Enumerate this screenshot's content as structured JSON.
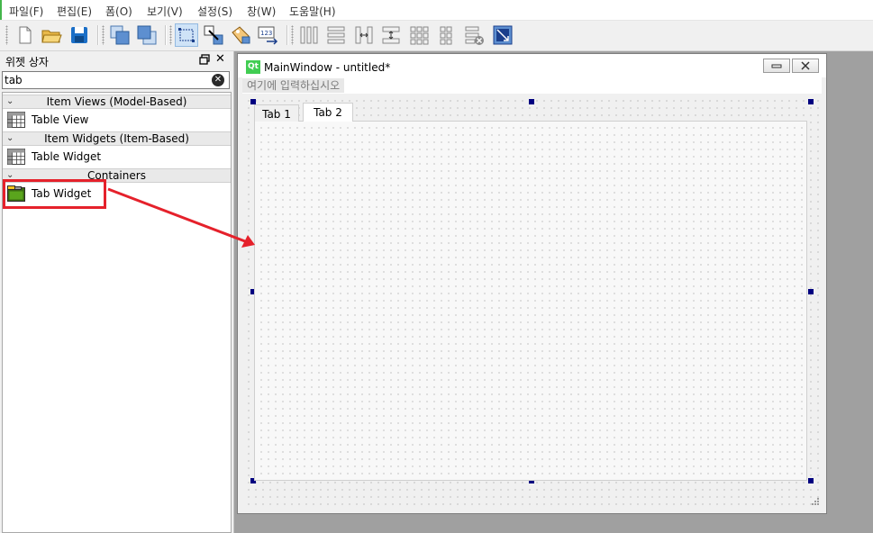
{
  "menubar": {
    "items": [
      "파일(F)",
      "편집(E)",
      "폼(O)",
      "보기(V)",
      "설정(S)",
      "창(W)",
      "도움말(H)"
    ]
  },
  "widget_box": {
    "title": "위젯 상자",
    "filter_value": "tab",
    "categories": [
      {
        "label": "Item Views (Model-Based)",
        "items": [
          {
            "label": "Table View",
            "icon": "table-icon"
          }
        ]
      },
      {
        "label": "Item Widgets (Item-Based)",
        "items": [
          {
            "label": "Table Widget",
            "icon": "table-icon"
          }
        ]
      },
      {
        "label": "Containers",
        "items": [
          {
            "label": "Tab Widget",
            "icon": "tab-widget-icon"
          }
        ]
      }
    ],
    "highlight_color": "#e5212b"
  },
  "form_window": {
    "title": "MainWindow - untitled*",
    "menu_placeholder": "여기에 입력하십시오",
    "tabs": [
      "Tab 1",
      "Tab 2"
    ],
    "active_tab": "Tab 2",
    "handle_color": "#000080"
  }
}
